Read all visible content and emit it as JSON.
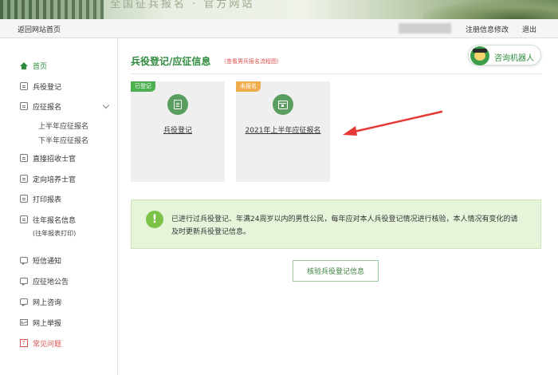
{
  "banner": {
    "slogan": "全国征兵报名 · 官方网站"
  },
  "topbar": {
    "back_label": "返回网站首页",
    "register_edit_label": "注册信息修改",
    "logout_label": "退出"
  },
  "sidebar": {
    "items": [
      {
        "label": "首页",
        "icon": "home-icon"
      },
      {
        "label": "兵役登记",
        "icon": "document-icon"
      },
      {
        "label": "应征报名",
        "icon": "document-icon"
      },
      {
        "label": "上半年应征报名"
      },
      {
        "label": "下半年应征报名"
      },
      {
        "label": "直接招收士官",
        "icon": "document-icon"
      },
      {
        "label": "定向培养士官",
        "icon": "document-icon"
      },
      {
        "label": "打印报表",
        "icon": "printer-icon"
      },
      {
        "label": "往年报名信息",
        "icon": "document-icon",
        "note": "(往年报表打印)"
      },
      {
        "label": "短信通知",
        "icon": "message-icon"
      },
      {
        "label": "应征地公告",
        "icon": "message-icon"
      },
      {
        "label": "网上咨询",
        "icon": "message-icon"
      },
      {
        "label": "网上举报",
        "icon": "mail-icon"
      },
      {
        "label": "常见问题",
        "icon": "question-icon"
      }
    ]
  },
  "main": {
    "title": "兵役登记/应征信息",
    "flow_link": "（查看男兵报名流程图）",
    "robot_label": "咨询机器人",
    "cards": [
      {
        "tag": "已登记",
        "label": "兵役登记",
        "icon": "document-icon"
      },
      {
        "tag": "未报名",
        "label": "2021年上半年应征报名",
        "icon": "calendar-icon"
      }
    ],
    "notice": "已进行过兵役登记、年满24周岁以内的男性公民，每年应对本人兵役登记情况进行核验，本人情况有变化的请及时更新兵役登记信息。",
    "verify_button": "核验兵役登记信息"
  },
  "colors": {
    "accent": "#2e8b3e",
    "notice_bg": "#e6f4da",
    "arrow": "#e53935",
    "tag_done": "#4caf50",
    "tag_pending": "#f0ad4e"
  }
}
